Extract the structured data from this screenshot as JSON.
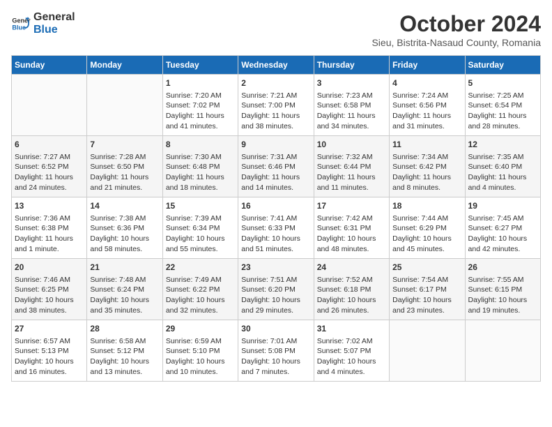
{
  "header": {
    "logo_line1": "General",
    "logo_line2": "Blue",
    "title": "October 2024",
    "subtitle": "Sieu, Bistrita-Nasaud County, Romania"
  },
  "days_of_week": [
    "Sunday",
    "Monday",
    "Tuesday",
    "Wednesday",
    "Thursday",
    "Friday",
    "Saturday"
  ],
  "weeks": [
    [
      {
        "day": "",
        "info": ""
      },
      {
        "day": "",
        "info": ""
      },
      {
        "day": "1",
        "info": "Sunrise: 7:20 AM\nSunset: 7:02 PM\nDaylight: 11 hours and 41 minutes."
      },
      {
        "day": "2",
        "info": "Sunrise: 7:21 AM\nSunset: 7:00 PM\nDaylight: 11 hours and 38 minutes."
      },
      {
        "day": "3",
        "info": "Sunrise: 7:23 AM\nSunset: 6:58 PM\nDaylight: 11 hours and 34 minutes."
      },
      {
        "day": "4",
        "info": "Sunrise: 7:24 AM\nSunset: 6:56 PM\nDaylight: 11 hours and 31 minutes."
      },
      {
        "day": "5",
        "info": "Sunrise: 7:25 AM\nSunset: 6:54 PM\nDaylight: 11 hours and 28 minutes."
      }
    ],
    [
      {
        "day": "6",
        "info": "Sunrise: 7:27 AM\nSunset: 6:52 PM\nDaylight: 11 hours and 24 minutes."
      },
      {
        "day": "7",
        "info": "Sunrise: 7:28 AM\nSunset: 6:50 PM\nDaylight: 11 hours and 21 minutes."
      },
      {
        "day": "8",
        "info": "Sunrise: 7:30 AM\nSunset: 6:48 PM\nDaylight: 11 hours and 18 minutes."
      },
      {
        "day": "9",
        "info": "Sunrise: 7:31 AM\nSunset: 6:46 PM\nDaylight: 11 hours and 14 minutes."
      },
      {
        "day": "10",
        "info": "Sunrise: 7:32 AM\nSunset: 6:44 PM\nDaylight: 11 hours and 11 minutes."
      },
      {
        "day": "11",
        "info": "Sunrise: 7:34 AM\nSunset: 6:42 PM\nDaylight: 11 hours and 8 minutes."
      },
      {
        "day": "12",
        "info": "Sunrise: 7:35 AM\nSunset: 6:40 PM\nDaylight: 11 hours and 4 minutes."
      }
    ],
    [
      {
        "day": "13",
        "info": "Sunrise: 7:36 AM\nSunset: 6:38 PM\nDaylight: 11 hours and 1 minute."
      },
      {
        "day": "14",
        "info": "Sunrise: 7:38 AM\nSunset: 6:36 PM\nDaylight: 10 hours and 58 minutes."
      },
      {
        "day": "15",
        "info": "Sunrise: 7:39 AM\nSunset: 6:34 PM\nDaylight: 10 hours and 55 minutes."
      },
      {
        "day": "16",
        "info": "Sunrise: 7:41 AM\nSunset: 6:33 PM\nDaylight: 10 hours and 51 minutes."
      },
      {
        "day": "17",
        "info": "Sunrise: 7:42 AM\nSunset: 6:31 PM\nDaylight: 10 hours and 48 minutes."
      },
      {
        "day": "18",
        "info": "Sunrise: 7:44 AM\nSunset: 6:29 PM\nDaylight: 10 hours and 45 minutes."
      },
      {
        "day": "19",
        "info": "Sunrise: 7:45 AM\nSunset: 6:27 PM\nDaylight: 10 hours and 42 minutes."
      }
    ],
    [
      {
        "day": "20",
        "info": "Sunrise: 7:46 AM\nSunset: 6:25 PM\nDaylight: 10 hours and 38 minutes."
      },
      {
        "day": "21",
        "info": "Sunrise: 7:48 AM\nSunset: 6:24 PM\nDaylight: 10 hours and 35 minutes."
      },
      {
        "day": "22",
        "info": "Sunrise: 7:49 AM\nSunset: 6:22 PM\nDaylight: 10 hours and 32 minutes."
      },
      {
        "day": "23",
        "info": "Sunrise: 7:51 AM\nSunset: 6:20 PM\nDaylight: 10 hours and 29 minutes."
      },
      {
        "day": "24",
        "info": "Sunrise: 7:52 AM\nSunset: 6:18 PM\nDaylight: 10 hours and 26 minutes."
      },
      {
        "day": "25",
        "info": "Sunrise: 7:54 AM\nSunset: 6:17 PM\nDaylight: 10 hours and 23 minutes."
      },
      {
        "day": "26",
        "info": "Sunrise: 7:55 AM\nSunset: 6:15 PM\nDaylight: 10 hours and 19 minutes."
      }
    ],
    [
      {
        "day": "27",
        "info": "Sunrise: 6:57 AM\nSunset: 5:13 PM\nDaylight: 10 hours and 16 minutes."
      },
      {
        "day": "28",
        "info": "Sunrise: 6:58 AM\nSunset: 5:12 PM\nDaylight: 10 hours and 13 minutes."
      },
      {
        "day": "29",
        "info": "Sunrise: 6:59 AM\nSunset: 5:10 PM\nDaylight: 10 hours and 10 minutes."
      },
      {
        "day": "30",
        "info": "Sunrise: 7:01 AM\nSunset: 5:08 PM\nDaylight: 10 hours and 7 minutes."
      },
      {
        "day": "31",
        "info": "Sunrise: 7:02 AM\nSunset: 5:07 PM\nDaylight: 10 hours and 4 minutes."
      },
      {
        "day": "",
        "info": ""
      },
      {
        "day": "",
        "info": ""
      }
    ]
  ]
}
